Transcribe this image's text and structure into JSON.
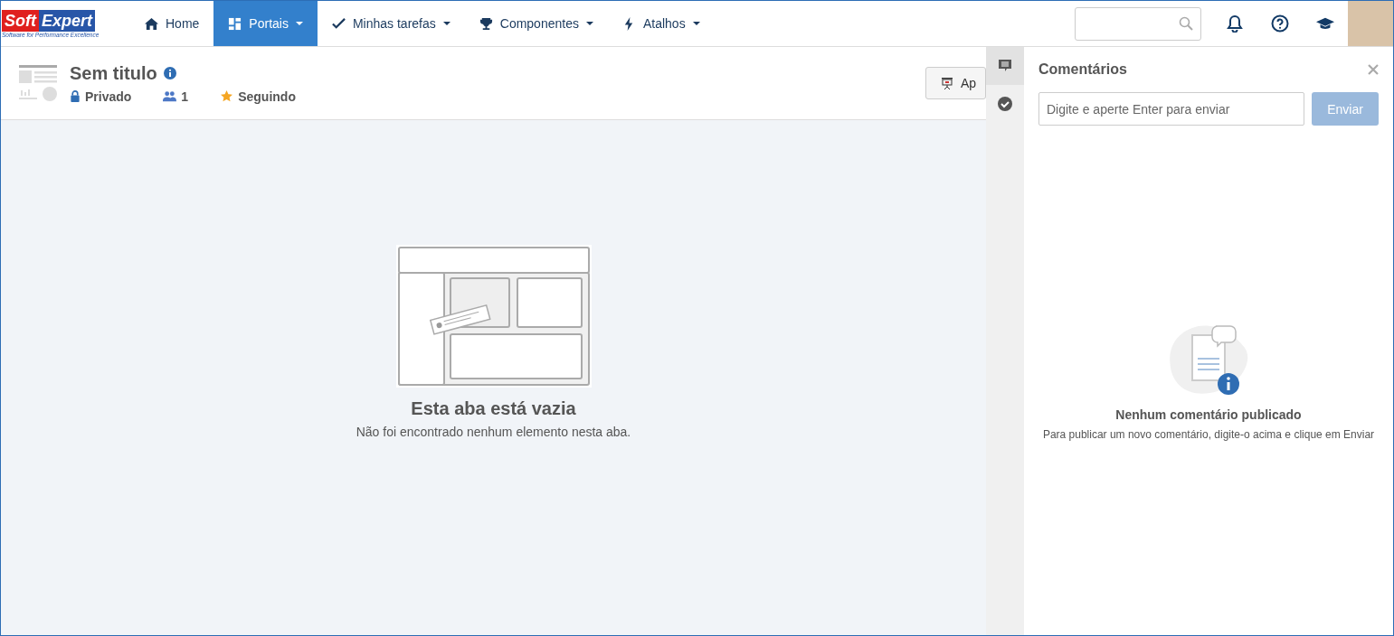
{
  "logo": {
    "brand_left": "Soft",
    "brand_right": "Expert",
    "tagline": "Software for Performance Excellence"
  },
  "nav": [
    {
      "label": "Home",
      "kind": "home",
      "selected": false,
      "dropdown": false
    },
    {
      "label": "Portais",
      "kind": "portal",
      "selected": true,
      "dropdown": true
    },
    {
      "label": "Minhas tarefas",
      "kind": "check",
      "selected": false,
      "dropdown": true
    },
    {
      "label": "Componentes",
      "kind": "trophy",
      "selected": false,
      "dropdown": true
    },
    {
      "label": "Atalhos",
      "kind": "bolt",
      "selected": false,
      "dropdown": true
    }
  ],
  "page": {
    "title": "Sem titulo",
    "privacy": "Privado",
    "members": "1",
    "follow": "Seguindo",
    "button": "Ap"
  },
  "empty": {
    "title": "Esta aba está vazia",
    "text": "Não foi encontrado nenhum elemento nesta aba."
  },
  "side_tabs": [
    {
      "kind": "comments",
      "selected": true
    },
    {
      "kind": "check",
      "selected": false
    }
  ],
  "comments": {
    "title": "Comentários",
    "placeholder": "Digite e aperte Enter para enviar",
    "send": "Enviar",
    "empty_title": "Nenhum comentário publicado",
    "empty_text": "Para publicar um novo comentário, digite-o acima e clique em Enviar"
  }
}
